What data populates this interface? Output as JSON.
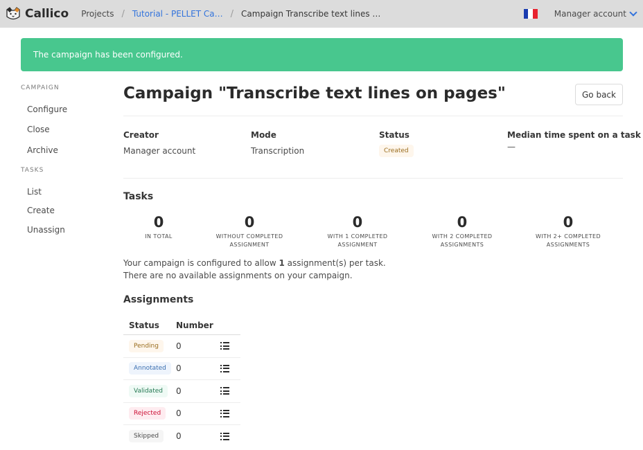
{
  "app": {
    "name": "Callico"
  },
  "breadcrumb": {
    "home": "Projects",
    "project": "Tutorial - PELLET Ca…",
    "current": "Campaign Transcribe text lines …"
  },
  "nav": {
    "account": "Manager account",
    "flag_colors": [
      "#1a3cb0",
      "#ffffff",
      "#e8232f"
    ]
  },
  "notification": {
    "text": "The campaign has been configured.",
    "color": "#48c78e"
  },
  "sidebar": {
    "campaign_label": "CAMPAIGN",
    "campaign_items": [
      {
        "label": "Configure"
      },
      {
        "label": "Close"
      },
      {
        "label": "Archive"
      }
    ],
    "tasks_label": "TASKS",
    "task_items": [
      {
        "label": "List"
      },
      {
        "label": "Create"
      },
      {
        "label": "Unassign"
      }
    ]
  },
  "main": {
    "title": "Campaign \"Transcribe text lines on pages\"",
    "go_back": "Go back",
    "info": {
      "creator_label": "Creator",
      "creator_value": "Manager account",
      "mode_label": "Mode",
      "mode_value": "Transcription",
      "status_label": "Status",
      "status_value": "Created",
      "median_label": "Median time spent on a task",
      "median_value": "—"
    },
    "tasks_title": "Tasks",
    "stats": [
      {
        "value": "0",
        "label1": "IN TOTAL",
        "label2": ""
      },
      {
        "value": "0",
        "label1": "WITHOUT COMPLETED",
        "label2": "ASSIGNMENT"
      },
      {
        "value": "0",
        "label1": "WITH 1 COMPLETED",
        "label2": "ASSIGNMENT"
      },
      {
        "value": "0",
        "label1": "WITH 2 COMPLETED",
        "label2": "ASSIGNMENTS"
      },
      {
        "value": "0",
        "label1": "WITH 2+ COMPLETED",
        "label2": "ASSIGNMENTS"
      }
    ],
    "config_text_before": "Your campaign is configured to allow ",
    "config_count": "1",
    "config_text_after": " assignment(s) per task.",
    "no_assign_text": "There are no available assignments on your campaign.",
    "assignments_title": "Assignments",
    "assignments_headers": {
      "status": "Status",
      "number": "Number"
    },
    "assignments": [
      {
        "status": "Pending",
        "number": "0"
      },
      {
        "status": "Annotated",
        "number": "0"
      },
      {
        "status": "Validated",
        "number": "0"
      },
      {
        "status": "Rejected",
        "number": "0"
      },
      {
        "status": "Skipped",
        "number": "0"
      }
    ]
  }
}
